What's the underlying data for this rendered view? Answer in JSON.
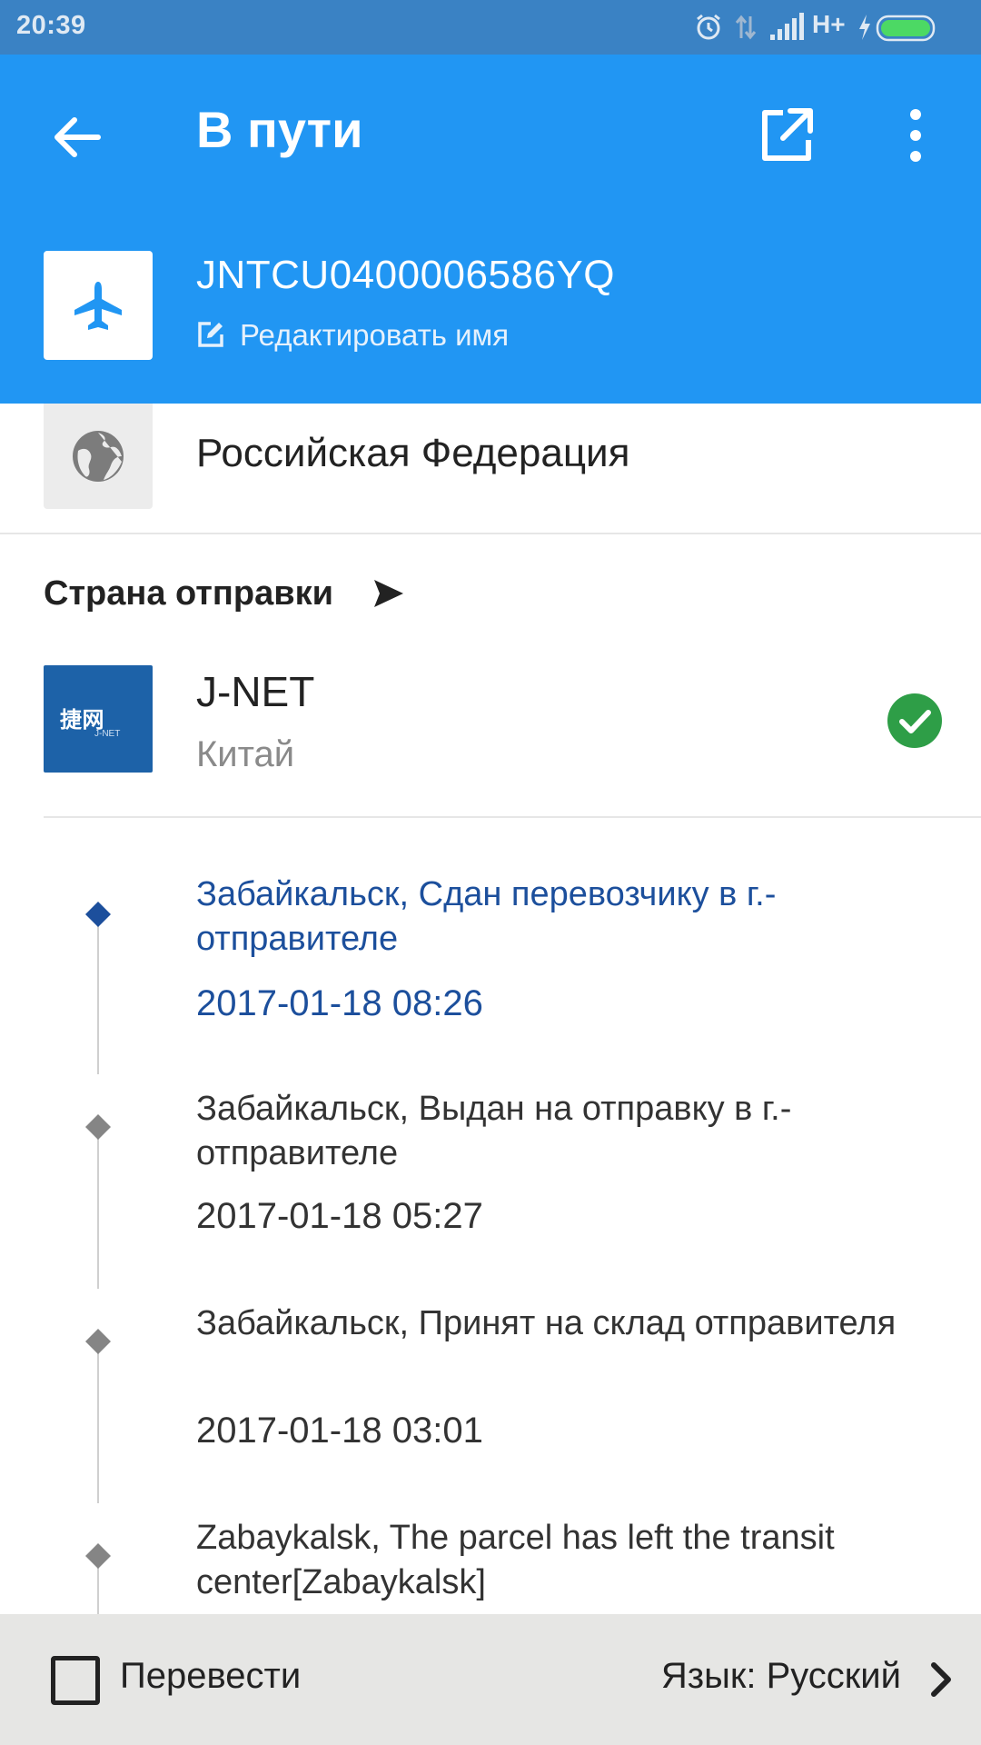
{
  "status_bar": {
    "time": "20:39",
    "network_type": "H+",
    "icons": [
      "alarm-icon",
      "data-transfer-icon",
      "signal-icon",
      "charging-icon",
      "battery-icon"
    ]
  },
  "app_bar": {
    "title": "В пути",
    "back_icon": "arrow-left-icon",
    "share_icon": "open-external-icon",
    "menu_icon": "more-vertical-icon"
  },
  "header": {
    "tracking_number": "JNTCU0400006586YQ",
    "edit_name_label": "Редактировать имя",
    "carrier_icon": "airplane-icon"
  },
  "destination": {
    "country": "Российская Федерация",
    "icon": "globe-icon"
  },
  "origin": {
    "heading": "Страна отправки",
    "carrier_name": "J-NET",
    "country": "Китай",
    "logo_text": "捷网",
    "logo_subtext": "J-NET",
    "status_icon": "check-circle-icon"
  },
  "events": [
    {
      "text": "Забайкальск, Сдан перевозчику в г.-отправителе",
      "time": "2017-01-18 08:26",
      "current": true
    },
    {
      "text": "Забайкальск, Выдан на отправку в г.-отправителе",
      "time": "2017-01-18 05:27",
      "current": false
    },
    {
      "text": "Забайкальск, Принят на склад отправителя",
      "time": "2017-01-18 03:01",
      "current": false
    },
    {
      "text": "Zabaykalsk, The parcel has left the transit center[Zabaykalsk]",
      "time": "",
      "current": false
    }
  ],
  "bottom_bar": {
    "translate_label": "Перевести",
    "translate_checked": false,
    "language_label": "Язык: Русский"
  },
  "colors": {
    "primary": "#2196f3",
    "status_bar": "#3a82c4",
    "current_event": "#1c4f9c",
    "check_green": "#2e9e47",
    "jnet_blue": "#1d62a8"
  }
}
